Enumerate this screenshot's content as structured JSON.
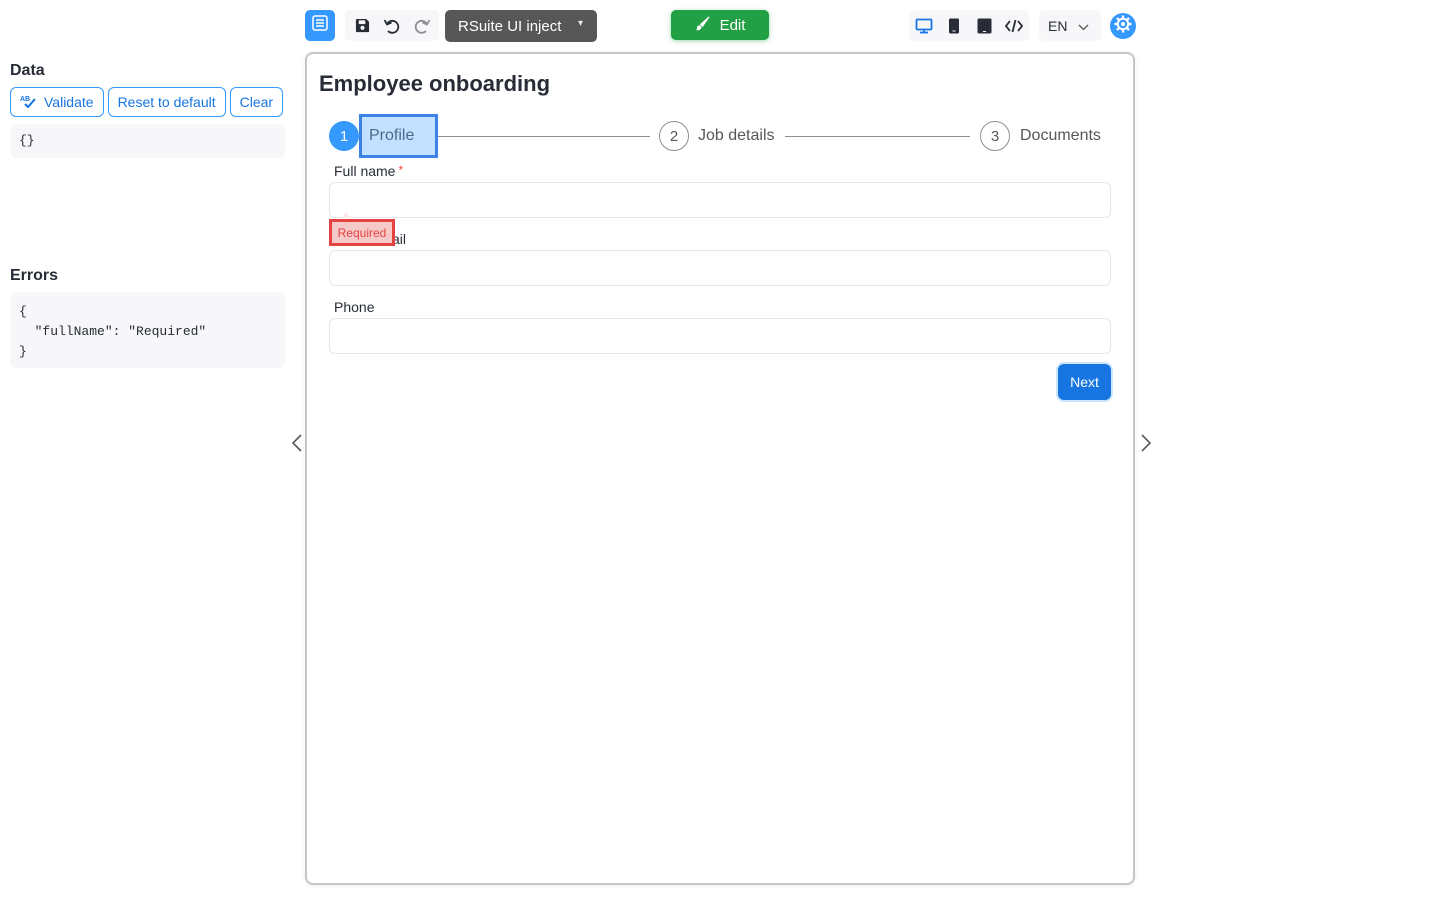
{
  "left": {
    "data_title": "Data",
    "buttons": {
      "validate": "Validate",
      "reset": "Reset to default",
      "clear": "Clear"
    },
    "data_code": "{}",
    "errors_title": "Errors",
    "errors_code": "{\n  \"fullName\": \"Required\"\n}"
  },
  "toolbar": {
    "theme_selected": "RSuite UI inject",
    "edit_label": "Edit",
    "language": "EN",
    "icons": [
      "menu-icon",
      "save-icon",
      "undo-icon",
      "redo-icon",
      "desktop-icon",
      "phone-icon",
      "tablet-icon",
      "code-icon",
      "chevron-down-icon",
      "settings-icon",
      "brush-icon"
    ]
  },
  "form": {
    "title": "Employee onboarding",
    "steps": [
      {
        "number": "1",
        "label": "Profile",
        "state": "active"
      },
      {
        "number": "2",
        "label": "Job details",
        "state": "wait"
      },
      {
        "number": "3",
        "label": "Documents",
        "state": "wait"
      }
    ],
    "fields": {
      "full_name": {
        "label": "Full name",
        "required_mark": "*",
        "value": ""
      },
      "email": {
        "label": "ail",
        "value": ""
      },
      "phone": {
        "label": "Phone",
        "value": ""
      }
    },
    "error_tooltip": "Required",
    "next_label": "Next"
  },
  "colors": {
    "primary": "#3498ff",
    "primary_dark": "#1675e0",
    "edit_green": "#22a045",
    "error": "#e54242",
    "highlight": "#3c82e6"
  }
}
